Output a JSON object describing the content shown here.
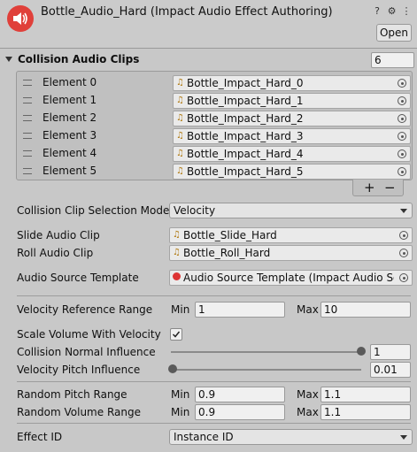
{
  "header": {
    "title": "Bottle_Audio_Hard (Impact Audio Effect Authoring)",
    "open_label": "Open",
    "help_glyph": "?",
    "settings_glyph": "⚙",
    "menu_glyph": "⋮"
  },
  "collision_clips": {
    "title": "Collision Audio Clips",
    "count": "6",
    "items": [
      {
        "label": "Element 0",
        "value": "Bottle_Impact_Hard_0"
      },
      {
        "label": "Element 1",
        "value": "Bottle_Impact_Hard_1"
      },
      {
        "label": "Element 2",
        "value": "Bottle_Impact_Hard_2"
      },
      {
        "label": "Element 3",
        "value": "Bottle_Impact_Hard_3"
      },
      {
        "label": "Element 4",
        "value": "Bottle_Impact_Hard_4"
      },
      {
        "label": "Element 5",
        "value": "Bottle_Impact_Hard_5"
      }
    ],
    "add_glyph": "+",
    "remove_glyph": "−"
  },
  "selection_mode": {
    "label": "Collision Clip Selection Mode",
    "value": "Velocity"
  },
  "slide_clip": {
    "label": "Slide Audio Clip",
    "value": "Bottle_Slide_Hard"
  },
  "roll_clip": {
    "label": "Roll Audio Clip",
    "value": "Bottle_Roll_Hard"
  },
  "audio_template": {
    "label": "Audio Source Template",
    "value": "Audio Source Template (Impact Audio Sour"
  },
  "velocity_ref": {
    "label": "Velocity Reference Range",
    "min_label": "Min",
    "min": "1",
    "max_label": "Max",
    "max": "10"
  },
  "scale_volume": {
    "label": "Scale Volume With Velocity",
    "checked": true
  },
  "normal_influence": {
    "label": "Collision Normal Influence",
    "value": "1",
    "level": 1.0
  },
  "pitch_influence": {
    "label": "Velocity Pitch Influence",
    "value": "0.01",
    "level": 0.01
  },
  "random_pitch": {
    "label": "Random Pitch Range",
    "min_label": "Min",
    "min": "0.9",
    "max_label": "Max",
    "max": "1.1"
  },
  "random_volume": {
    "label": "Random Volume Range",
    "min_label": "Min",
    "min": "0.9",
    "max_label": "Max",
    "max": "1.1"
  },
  "effect_id": {
    "label": "Effect ID",
    "value": "Instance ID"
  },
  "colors": {
    "accent": "#e0403a",
    "clip_icon": "#b07a12"
  }
}
